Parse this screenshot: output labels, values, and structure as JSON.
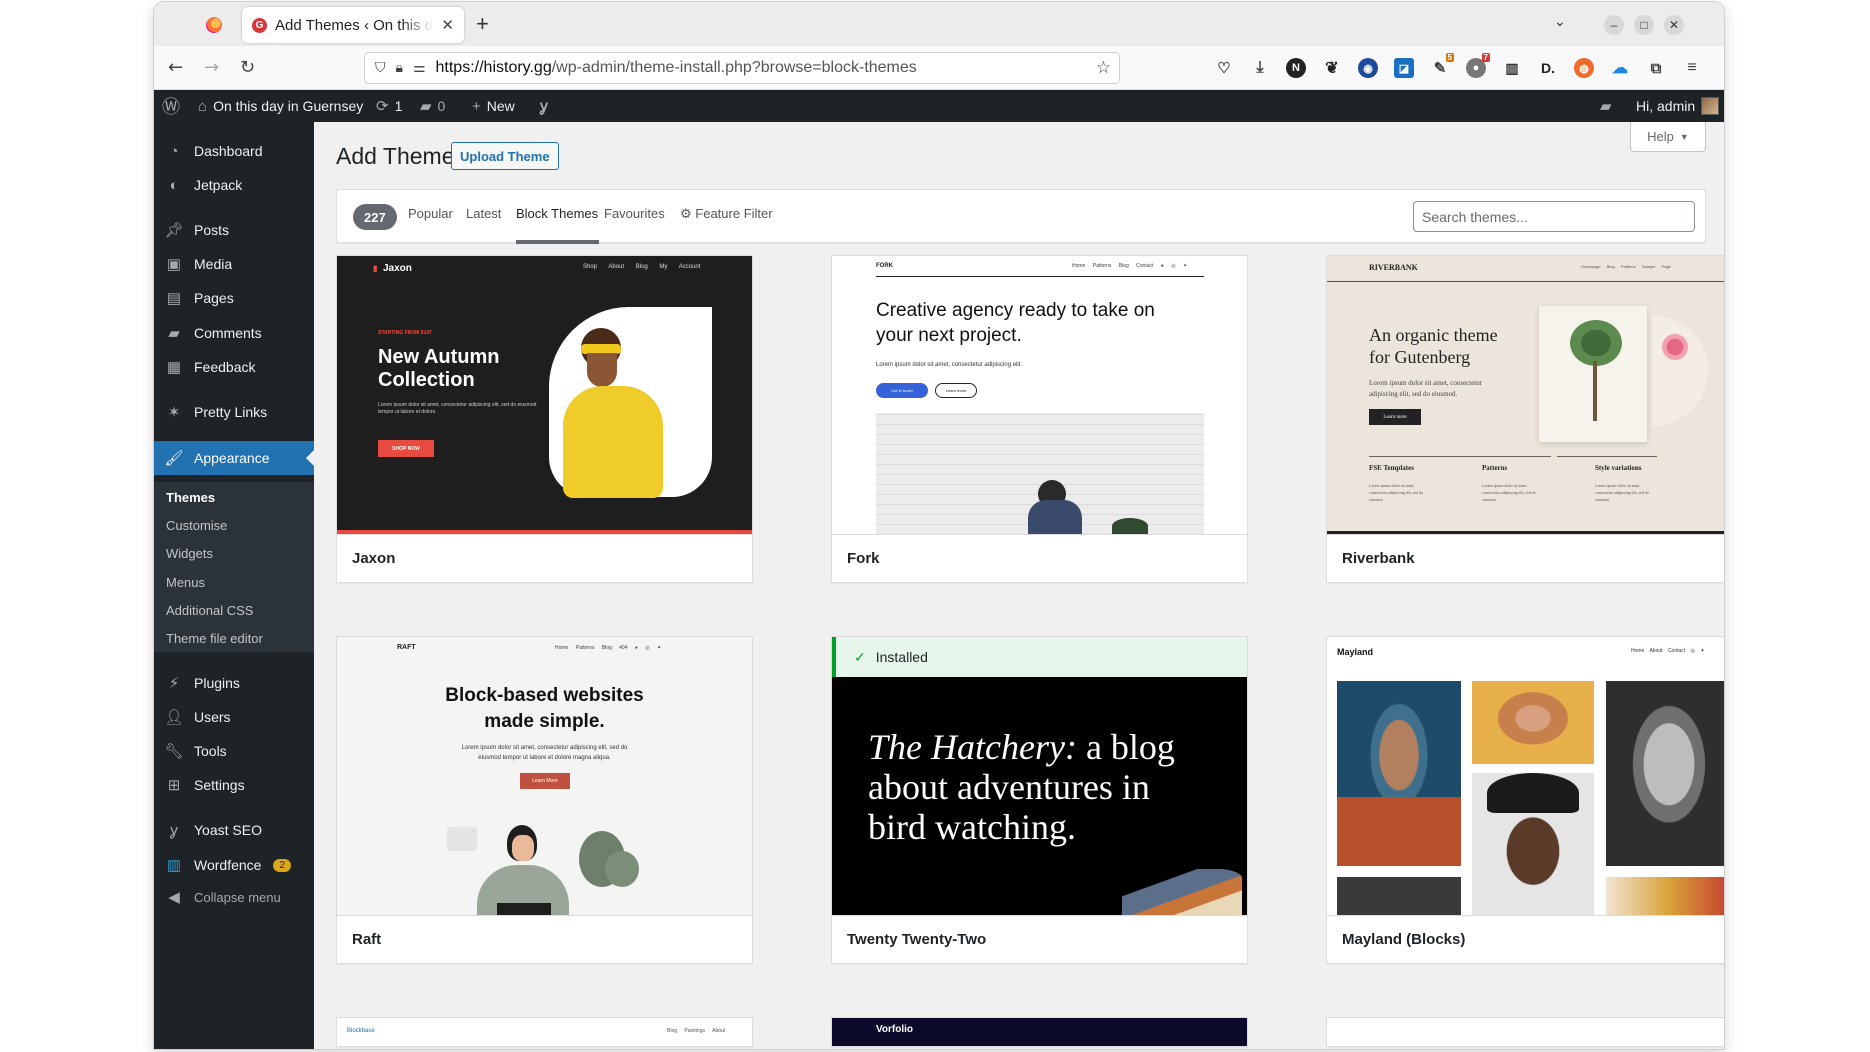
{
  "browser": {
    "tab_title": "Add Themes ‹ On this day in Guernsey",
    "tab_favicon": "G",
    "new_tab": "+",
    "url_host": "https://history.gg",
    "url_path": "/wp-admin/theme-install.php?browse=block-themes",
    "extension_badges": {
      "notifications": "5",
      "alerts": "7"
    }
  },
  "adminbar": {
    "site_name": "On this day in Guernsey",
    "updates_count": "1",
    "comments_count": "0",
    "new_label": "New",
    "greeting": "Hi, admin"
  },
  "sidebar": {
    "items": [
      {
        "label": "Dashboard",
        "icon": "dashboard-icon"
      },
      {
        "label": "Jetpack",
        "icon": "jetpack-icon"
      },
      {
        "label": "Posts",
        "icon": "pin-icon"
      },
      {
        "label": "Media",
        "icon": "media-icon"
      },
      {
        "label": "Pages",
        "icon": "pages-icon"
      },
      {
        "label": "Comments",
        "icon": "comment-icon"
      },
      {
        "label": "Feedback",
        "icon": "feedback-icon"
      },
      {
        "label": "Pretty Links",
        "icon": "star-link-icon"
      },
      {
        "label": "Appearance",
        "icon": "paintbrush-icon"
      },
      {
        "label": "Plugins",
        "icon": "plugin-icon"
      },
      {
        "label": "Users",
        "icon": "user-icon"
      },
      {
        "label": "Tools",
        "icon": "wrench-icon"
      },
      {
        "label": "Settings",
        "icon": "settings-icon"
      },
      {
        "label": "Yoast SEO",
        "icon": "yoast-icon"
      },
      {
        "label": "Wordfence",
        "icon": "wordfence-icon",
        "badge": "2"
      },
      {
        "label": "Collapse menu",
        "icon": "collapse-icon"
      }
    ],
    "submenu": [
      "Themes",
      "Customise",
      "Widgets",
      "Menus",
      "Additional CSS",
      "Theme file editor"
    ]
  },
  "page": {
    "title": "Add Themes",
    "upload_label": "Upload Theme",
    "help_label": "Help",
    "count": "227",
    "filters": [
      "Popular",
      "Latest",
      "Block Themes",
      "Favourites",
      "Feature Filter"
    ],
    "search_placeholder": "Search themes..."
  },
  "themes": [
    {
      "name": "Jaxon",
      "logo": "Jaxon",
      "nav": [
        "Shop",
        "About",
        "Blog",
        "My Account"
      ],
      "kicker": "STARTING FROM $147",
      "headline_1": "New Autumn",
      "headline_2": "Collection",
      "body": "Lorem ipsum dolor sit amet, consectetur adipiscing elit, sed do eiusmod tempor ut labore et dolore.",
      "cta": "SHOP NOW"
    },
    {
      "name": "Fork",
      "logo": "FORK",
      "nav": [
        "Home",
        "Patterns",
        "Blog",
        "Contact"
      ],
      "headline_1": "Creative agency ready to take on",
      "headline_2": "your next project.",
      "body": "Lorem ipsum dolor sit amet, consectetur adipiscing elit.",
      "cta_1": "Get in touch",
      "cta_2": "Learn more"
    },
    {
      "name": "Riverbank",
      "logo": "RIVERBANK",
      "nav": [
        "Homepage",
        "Blog",
        "Patterns",
        "Sample Page"
      ],
      "headline_1": "An organic theme",
      "headline_2": "for Gutenberg",
      "body_1": "Lorem ipsum dolor sit amet, consectetur",
      "body_2": "adipiscing elit, sed do eiusmod.",
      "cta": "Learn more",
      "columns": [
        "FSE Templates",
        "Patterns",
        "Style variations"
      ],
      "col_body_1": "Lorem ipsum dolor sit amet,",
      "col_body_2": "consectetur adipiscing elit, sed do",
      "col_body_3": "eiusmod."
    },
    {
      "name": "Raft",
      "logo": "RAFT",
      "nav": [
        "Home",
        "Patterns",
        "Blog",
        "404"
      ],
      "headline_1": "Block-based websites",
      "headline_2": "made simple.",
      "body_1": "Lorem ipsum dolor sit amet, consectetur adipiscing elit, sed do",
      "body_2": "eiusmod tempor ut labore et dolore magna aliqua.",
      "cta": "Learn More"
    },
    {
      "name": "Twenty Twenty-Two",
      "installed": "Installed",
      "headline_em": "The Hatchery:",
      "headline_1": " a blog",
      "headline_2": "about adventures in",
      "headline_3": "bird watching."
    },
    {
      "name": "Mayland (Blocks)",
      "logo": "Mayland",
      "nav": [
        "Home",
        "About",
        "Contact"
      ]
    }
  ],
  "partial_row": {
    "blockbase": "Blockbase",
    "blockbase_nav": [
      "Blog",
      "Paintings",
      "About"
    ],
    "vorfolio": "Vorfolio"
  },
  "colors": {
    "admin_dark": "#1d2327",
    "admin_blue": "#2271b1",
    "jaxon_red": "#e94a3f",
    "installed_green": "#00a32a"
  }
}
